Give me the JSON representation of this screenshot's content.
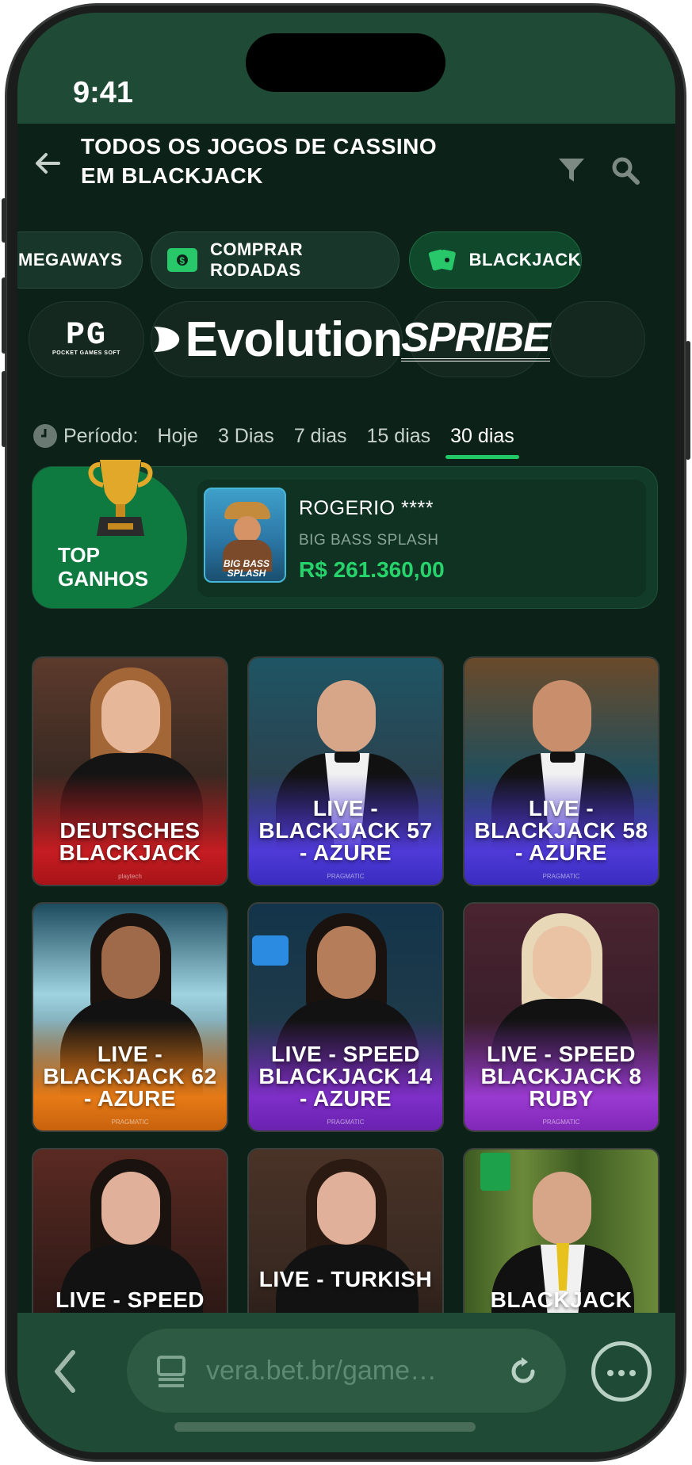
{
  "status": {
    "time": "9:41"
  },
  "header": {
    "title_line1": "TODOS OS JOGOS DE CASSINO",
    "title_line2": "EM BLACKJACK"
  },
  "categories": [
    {
      "label": "MEGAWAYS",
      "icon": "none",
      "active": false
    },
    {
      "label": "COMPRAR RODADAS",
      "icon": "money-icon",
      "active": false
    },
    {
      "label": "BLACKJACK",
      "icon": "cards-icon",
      "active": true
    }
  ],
  "providers": [
    {
      "name": "PG",
      "sub": "POCKET GAMES SOFT"
    },
    {
      "name": "Evolution"
    },
    {
      "name": "SPRIBE"
    }
  ],
  "period": {
    "label": "Período:",
    "options": [
      "Hoje",
      "3 Dias",
      "7 dias",
      "15 dias",
      "30 dias"
    ],
    "active": "30 dias"
  },
  "top_wins": {
    "label_line1": "TOP",
    "label_line2": "GANHOS",
    "winner": "ROGERIO ****",
    "game": "BIG BASS SPLASH",
    "game_thumb_text": "BIG BASS SPLASH",
    "amount": "R$ 261.360,00"
  },
  "games": [
    {
      "title": "DEUTSCHES BLACKJACK",
      "theme": "red"
    },
    {
      "title": "LIVE - BLACKJACK 57 - AZURE",
      "theme": "blue"
    },
    {
      "title": "LIVE - BLACKJACK 58 - AZURE",
      "theme": "blue"
    },
    {
      "title": "LIVE - BLACKJACK 62 - AZURE",
      "theme": "orange"
    },
    {
      "title": "LIVE - SPEED BLACKJACK 14 - AZURE",
      "theme": "purple"
    },
    {
      "title": "LIVE - SPEED BLACKJACK 8 RUBY",
      "theme": "violet"
    },
    {
      "title": "LIVE - SPEED",
      "theme": "dark"
    },
    {
      "title": "LIVE - TURKISH",
      "theme": "dark"
    },
    {
      "title": "BLACKJACK",
      "theme": "green"
    }
  ],
  "browser": {
    "url": "vera.bet.br/game…"
  },
  "colors": {
    "accent_green": "#22c865",
    "bg": "#0c2218",
    "bar": "#1f4a35"
  }
}
